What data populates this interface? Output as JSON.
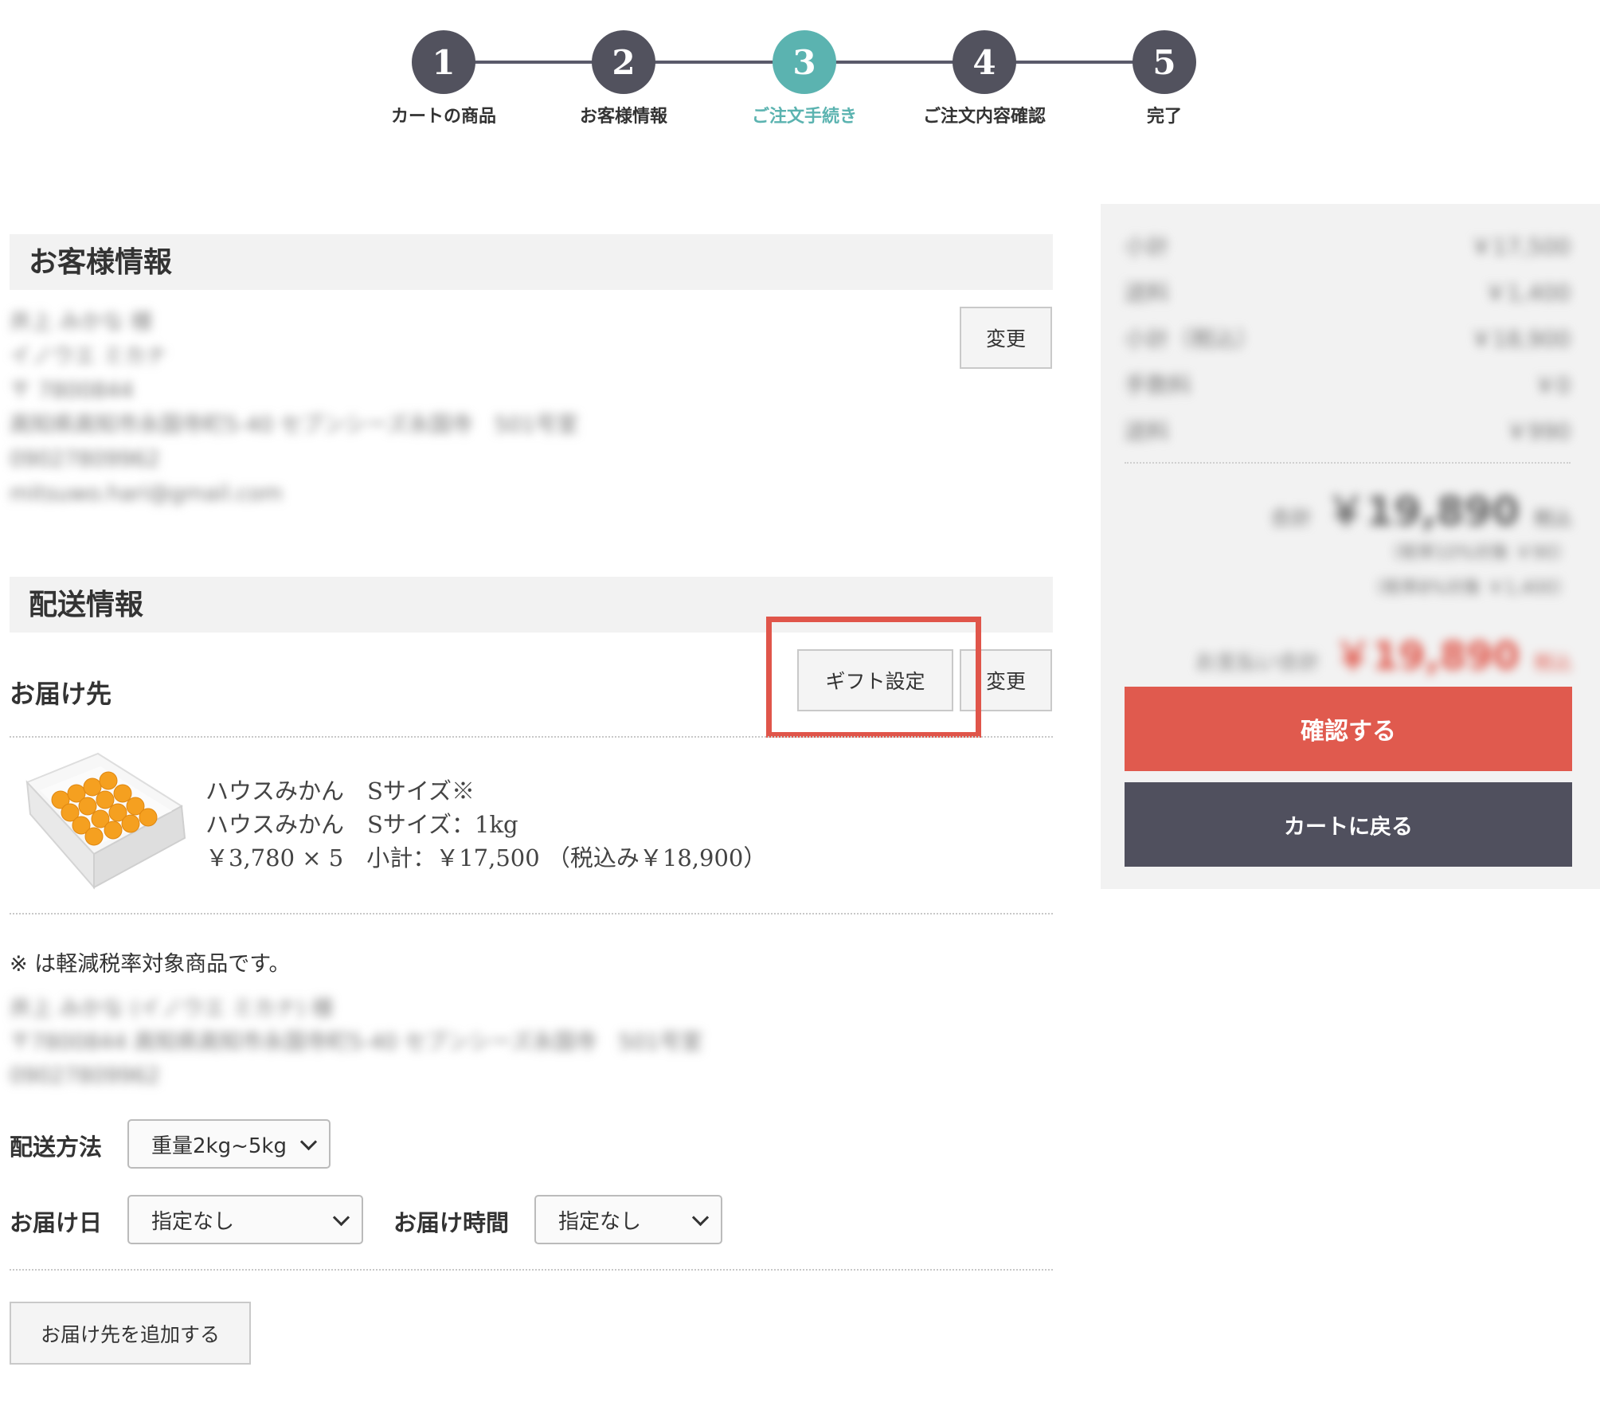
{
  "stepper": {
    "steps": [
      {
        "number": "1",
        "label": "カートの商品"
      },
      {
        "number": "2",
        "label": "お客様情報"
      },
      {
        "number": "3",
        "label": "ご注文手続き"
      },
      {
        "number": "4",
        "label": "ご注文内容確認"
      },
      {
        "number": "5",
        "label": "完了"
      }
    ],
    "active_step": 3,
    "colors": {
      "inactive": "#52525e",
      "active": "#5bb3b0"
    }
  },
  "customer": {
    "title": "お客様情報",
    "change_label": "変更",
    "blurred_lines": [
      "井上 みかな 様",
      "イノウエ ミカナ",
      "〒 7800844",
      "高知県高知市永国寺町5-40 セブンシーズ永国寺　501号室",
      "09027809962",
      "mitsuwo.hari@gmail.com"
    ]
  },
  "delivery": {
    "title": "配送情報",
    "destination_label": "お届け先",
    "gift_label": "ギフト設定",
    "change_label": "変更",
    "product": {
      "name1": "ハウスみかん　Sサイズ※",
      "name2": "ハウスみかん　Sサイズ：1kg",
      "price_line": "￥3,780 × 5　小計：￥17,500 （税込み￥18,900）",
      "image": "mikan-box-image"
    },
    "note": "※ は軽減税率対象商品です。",
    "blurred_address": [
      "井上 みかな (イノウエ ミカナ) 様",
      "〒7800844 高知県高知市永国寺町5-40 セブンシーズ永国寺　501号室",
      "09027809962"
    ],
    "method_label": "配送方法",
    "method_value": "重量2kg~5kg",
    "date_label": "お届け日",
    "date_value": "指定なし",
    "time_label": "お届け時間",
    "time_value": "指定なし",
    "add_destination_label": "お届け先を追加する"
  },
  "summary": {
    "rows": [
      {
        "label": "小計",
        "value": "￥17,500"
      },
      {
        "label": "送料",
        "value": "￥1,400"
      },
      {
        "label": "小計（税込）",
        "value": "￥18,900"
      },
      {
        "label": "手数料",
        "value": "￥0"
      },
      {
        "label": "送料",
        "value": "￥990"
      }
    ],
    "total_label": "合計",
    "total_value": "￥19,890",
    "tax_suffix": "税込",
    "tax_note1": "（税率10%対象 ￥90）",
    "tax_note2": "（税率8%対象 ￥1,400）",
    "payment_label": "お支払い合計",
    "payment_value": "￥19,890",
    "confirm_label": "確認する",
    "back_label": "カートに戻る",
    "colors": {
      "confirm": "#e05a4e",
      "back": "#50505e",
      "total_red": "#e05a4e"
    }
  }
}
